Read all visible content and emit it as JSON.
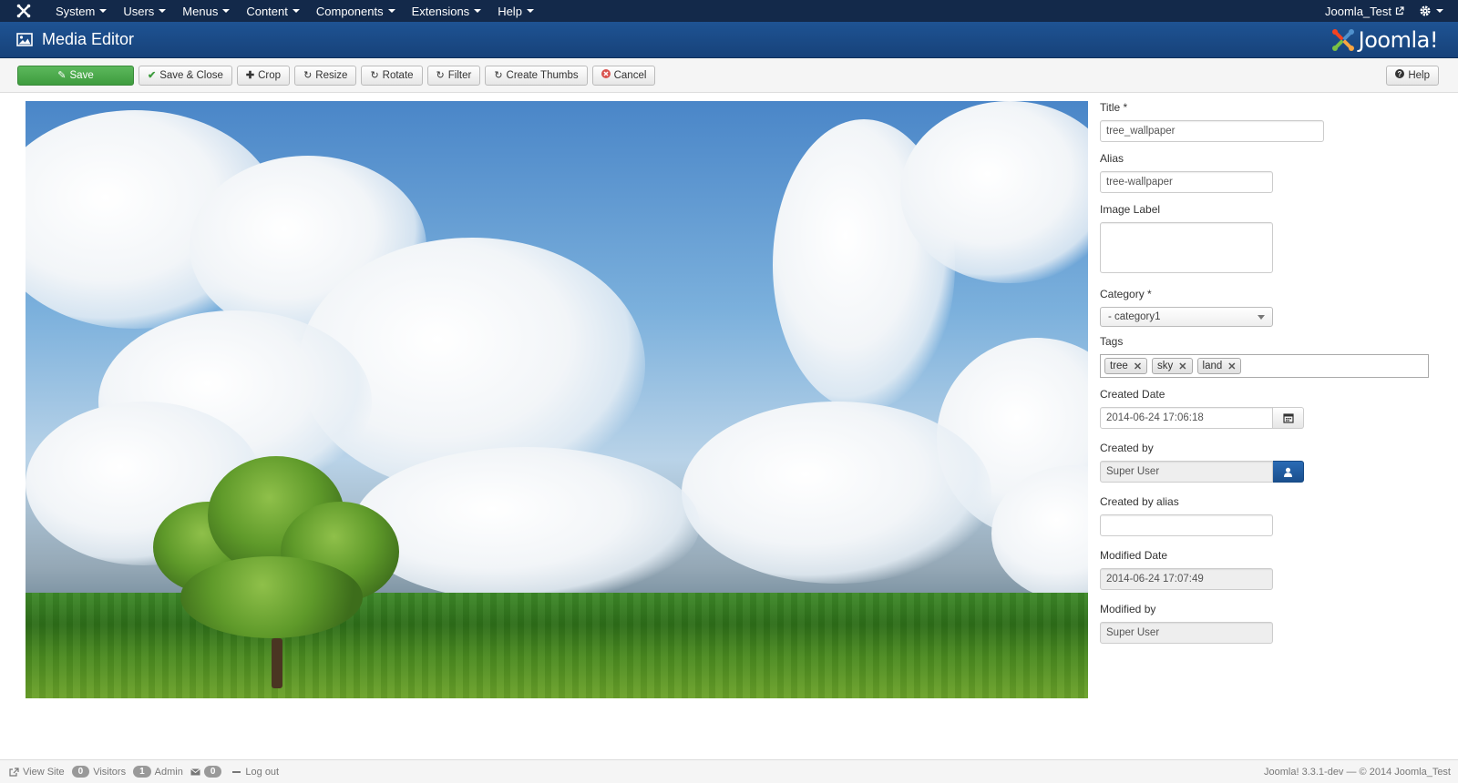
{
  "topnav": {
    "menus": [
      "System",
      "Users",
      "Menus",
      "Content",
      "Components",
      "Extensions",
      "Help"
    ],
    "site_name": "Joomla_Test"
  },
  "header": {
    "title": "Media Editor",
    "brand": "Joomla!"
  },
  "toolbar": {
    "save": "Save",
    "save_close": "Save & Close",
    "crop": "Crop",
    "resize": "Resize",
    "rotate": "Rotate",
    "filter": "Filter",
    "create_thumbs": "Create Thumbs",
    "cancel": "Cancel",
    "help": "Help"
  },
  "form": {
    "title": {
      "label": "Title *",
      "value": "tree_wallpaper"
    },
    "alias": {
      "label": "Alias",
      "value": "tree-wallpaper"
    },
    "image_label": {
      "label": "Image Label",
      "value": ""
    },
    "category": {
      "label": "Category *",
      "value": "- category1"
    },
    "tags": {
      "label": "Tags",
      "items": [
        "tree",
        "sky",
        "land"
      ]
    },
    "created_date": {
      "label": "Created Date",
      "value": "2014-06-24 17:06:18"
    },
    "created_by": {
      "label": "Created by",
      "value": "Super User"
    },
    "created_by_alias": {
      "label": "Created by alias",
      "value": ""
    },
    "modified_date": {
      "label": "Modified Date",
      "value": "2014-06-24 17:07:49"
    },
    "modified_by": {
      "label": "Modified by",
      "value": "Super User"
    }
  },
  "footer": {
    "view_site": "View Site",
    "visitors_count": "0",
    "visitors_label": "Visitors",
    "admin_count": "1",
    "admin_label": "Admin",
    "messages_count": "0",
    "logout": "Log out",
    "copyright": "Joomla! 3.3.1-dev  —  © 2014 Joomla_Test"
  },
  "colors": {
    "navbar": "#13294a",
    "header": "#1e5393",
    "save_button": "#5cb85c",
    "cancel_icon": "#d9534f"
  },
  "icons": {
    "joomla_nav": "joomla-logo-icon",
    "media": "image-icon",
    "calendar": "calendar-icon",
    "user": "user-icon",
    "gear": "gear-icon"
  }
}
